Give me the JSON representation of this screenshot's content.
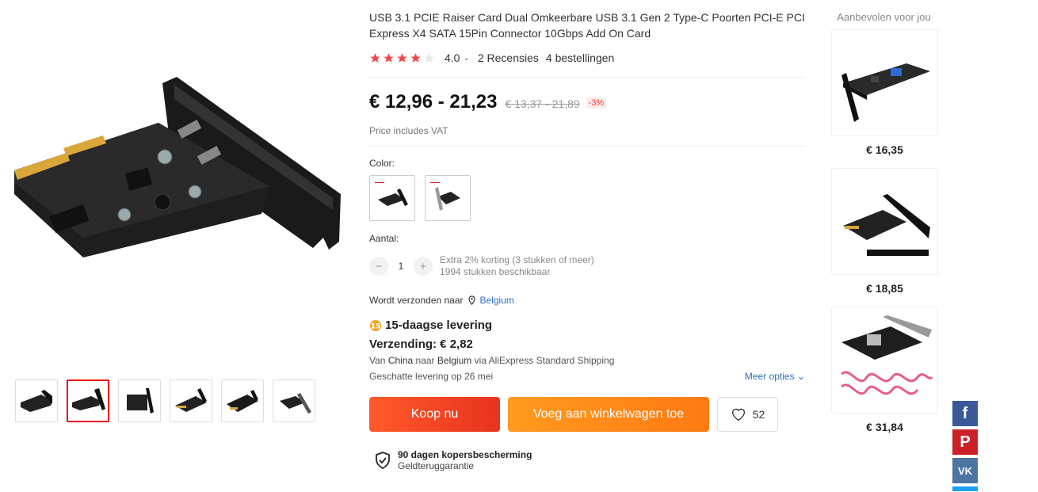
{
  "product": {
    "title": "USB 3.1 PCIE Raiser Card Dual Omkeerbare USB 3.1 Gen 2 Type-C Poorten PCI-E PCI Express X4 SATA 15Pin Connector 10Gbps Add On Card",
    "rating": "4.0",
    "rating_value": 4.0,
    "reviews": "2 Recensies",
    "orders": "4 bestellingen",
    "price": "€ 12,96 - 21,23",
    "old_price": "€ 13,37 - 21,89",
    "discount": "-3%",
    "vat_note": "Price includes VAT",
    "color_label": "Color:",
    "quantity_label": "Aantal:",
    "quantity": "1",
    "qty_note_1": "Extra 2% korting (3 stukken of meer)",
    "qty_note_2": "1994 stukken beschikbaar",
    "ship_to_label": "Wordt verzonden naar",
    "ship_to_country": "Belgium",
    "delivery_title": "15-daagse levering",
    "shipping_cost": "Verzending: € 2,82",
    "ship_from_prefix": "Van",
    "ship_from": "China",
    "ship_to_mid": "naar",
    "ship_to": "Belgium",
    "ship_via": "via AliExpress Standard Shipping",
    "estimate_prefix": "Geschatte levering op",
    "estimate_date": "26 mei",
    "more_options": "Meer opties",
    "buy_now": "Koop nu",
    "add_to_cart": "Voeg aan winkelwagen toe",
    "wishlist_count": "52",
    "protection_title": "90 dagen kopersbescherming",
    "protection_sub": "Geldteruggarantie"
  },
  "recommendations": {
    "title": "Aanbevolen voor jou",
    "items": [
      {
        "price": "€ 16,35"
      },
      {
        "price": "€ 18,85"
      },
      {
        "price": "€ 31,84"
      }
    ]
  },
  "colors": {
    "star_active": "#f5454b",
    "buy_button": "#e8331e",
    "cart_button": "#ff8a1a",
    "link": "#2f6ec9"
  }
}
